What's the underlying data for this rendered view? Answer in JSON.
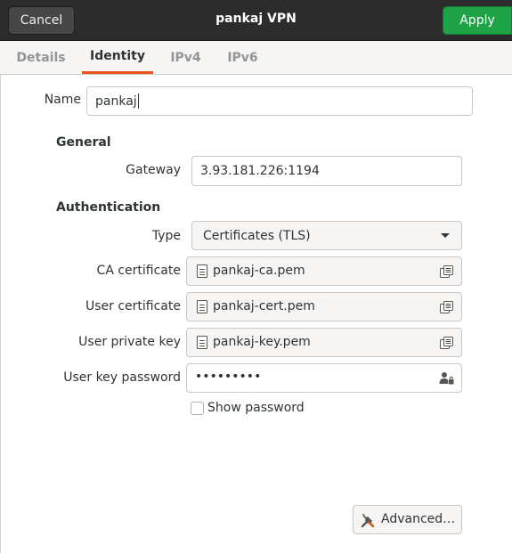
{
  "header": {
    "cancel_label": "Cancel",
    "title": "pankaj VPN",
    "apply_label": "Apply",
    "apply_color": "#1ea446"
  },
  "tabs": [
    {
      "label": "Details",
      "active": false
    },
    {
      "label": "Identity",
      "active": true
    },
    {
      "label": "IPv4",
      "active": false
    },
    {
      "label": "IPv6",
      "active": false
    }
  ],
  "accent_color": "#e95420",
  "identity": {
    "name_label": "Name",
    "name_value": "pankaj",
    "general_heading": "General",
    "gateway_label": "Gateway",
    "gateway_value": "3.93.181.226:1194",
    "auth_heading": "Authentication",
    "type_label": "Type",
    "type_value": "Certificates (TLS)",
    "ca_label": "CA certificate",
    "ca_value": "pankaj-ca.pem",
    "user_cert_label": "User certificate",
    "user_cert_value": "pankaj-cert.pem",
    "private_key_label": "User private key",
    "private_key_value": "pankaj-key.pem",
    "key_password_label": "User key password",
    "key_password_value": "•••••••••",
    "show_password_label": "Show password",
    "show_password_checked": false,
    "advanced_label": "Advanced…"
  }
}
